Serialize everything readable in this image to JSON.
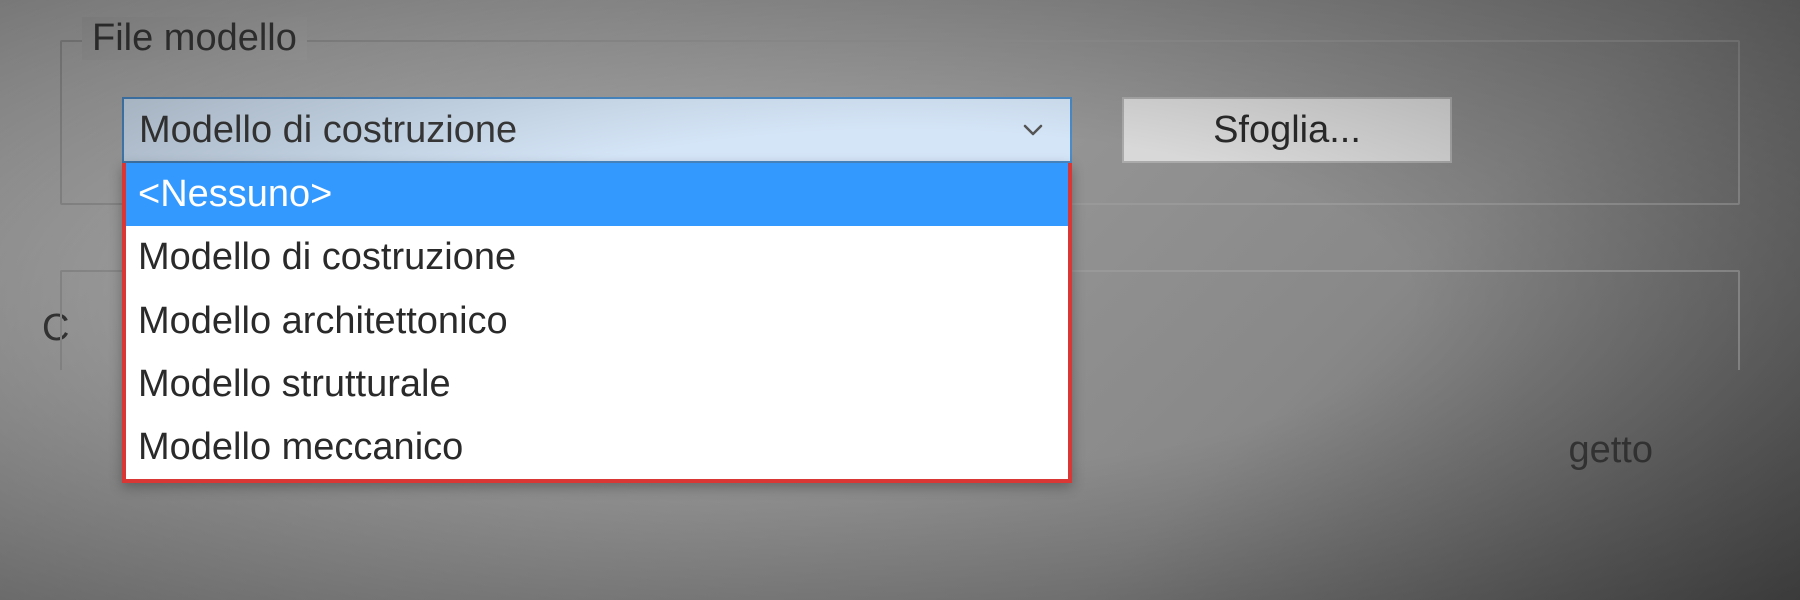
{
  "file_model": {
    "group_label": "File modello",
    "dropdown": {
      "selected": "Modello di costruzione",
      "options": [
        {
          "label": "<Nessuno>",
          "highlighted": true
        },
        {
          "label": "Modello di costruzione",
          "highlighted": false
        },
        {
          "label": "Modello architettonico",
          "highlighted": false
        },
        {
          "label": "Modello strutturale",
          "highlighted": false
        },
        {
          "label": "Modello meccanico",
          "highlighted": false
        }
      ]
    },
    "browse_label": "Sfoglia..."
  },
  "partial": {
    "radio_fragment": "C",
    "text_fragment": "getto"
  }
}
